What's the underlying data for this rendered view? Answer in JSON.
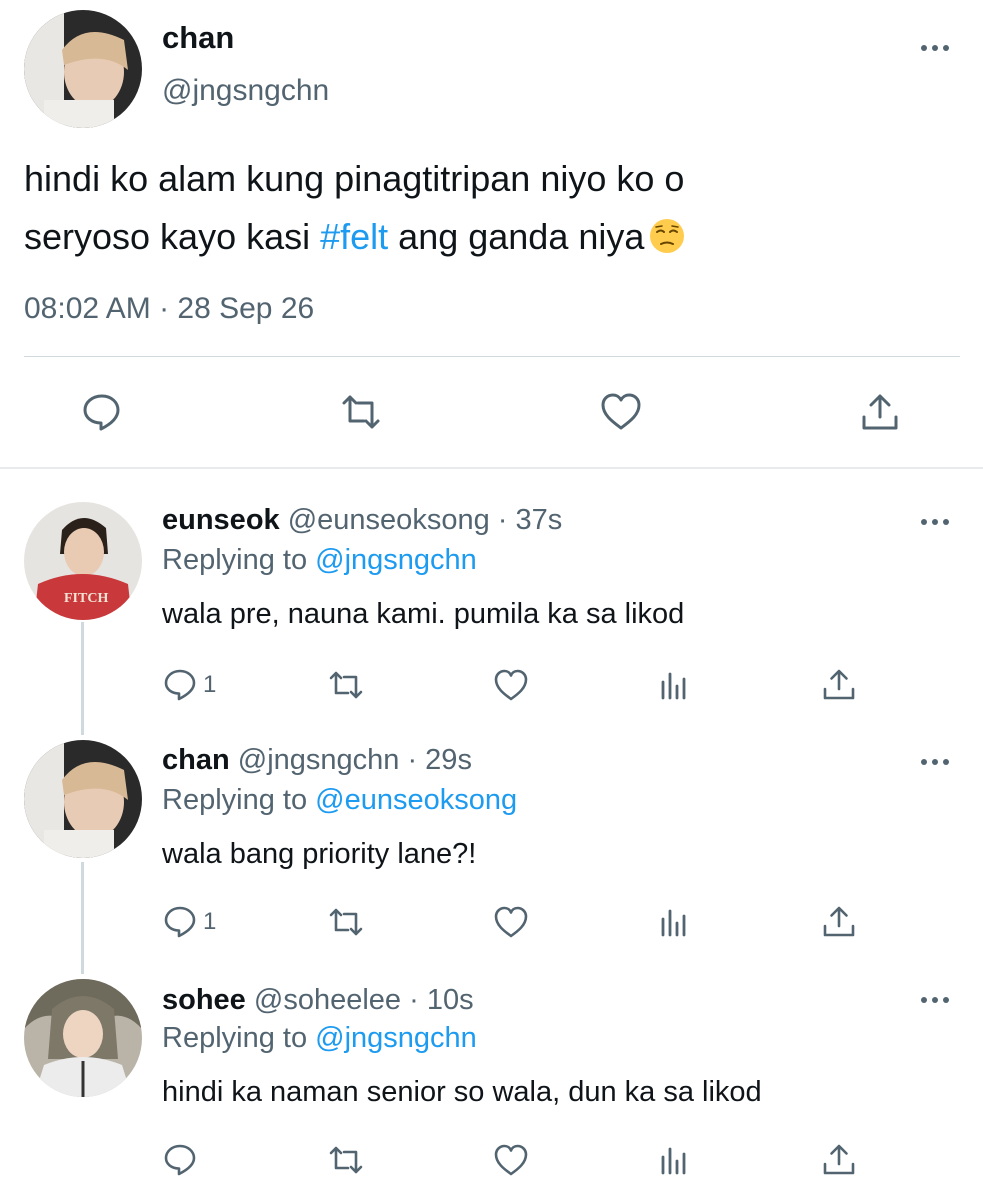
{
  "main_tweet": {
    "name": "chan",
    "handle": "@jngsngchn",
    "text_line1": "hindi ko alam kung pinagtitripan niyo ko o",
    "text_line2_before": "seryoso kayo kasi ",
    "hashtag": "#felt",
    "text_line2_after": " ang ganda niya",
    "emoji": "pensive-face-emoji",
    "timestamp": "08:02 AM · 28 Sep 26",
    "actions": [
      "reply-icon",
      "retweet-icon",
      "like-icon",
      "share-icon"
    ]
  },
  "replies": [
    {
      "name": "eunseok",
      "handle": "@eunseoksong",
      "time": "· 37s",
      "replying_prefix": "Replying to ",
      "replying_to": "@jngsngchn",
      "text": "wala pre, nauna kami. pumila ka sa likod",
      "reply_count": "1"
    },
    {
      "name": "chan",
      "handle": "@jngsngchn",
      "time": "· 29s",
      "replying_prefix": "Replying to ",
      "replying_to": "@eunseoksong",
      "text": "wala bang priority lane?!",
      "reply_count": "1"
    },
    {
      "name": "sohee",
      "handle": "@soheelee",
      "time": "· 10s",
      "replying_prefix": "Replying to ",
      "replying_to": "@jngsngchn",
      "text": "hindi ka naman senior so wala, dun ka sa likod",
      "reply_count": ""
    }
  ],
  "colors": {
    "accent": "#1d9bf0",
    "secondary_text": "#536471",
    "primary_text": "#0f1419",
    "divider": "#cfd9de"
  }
}
